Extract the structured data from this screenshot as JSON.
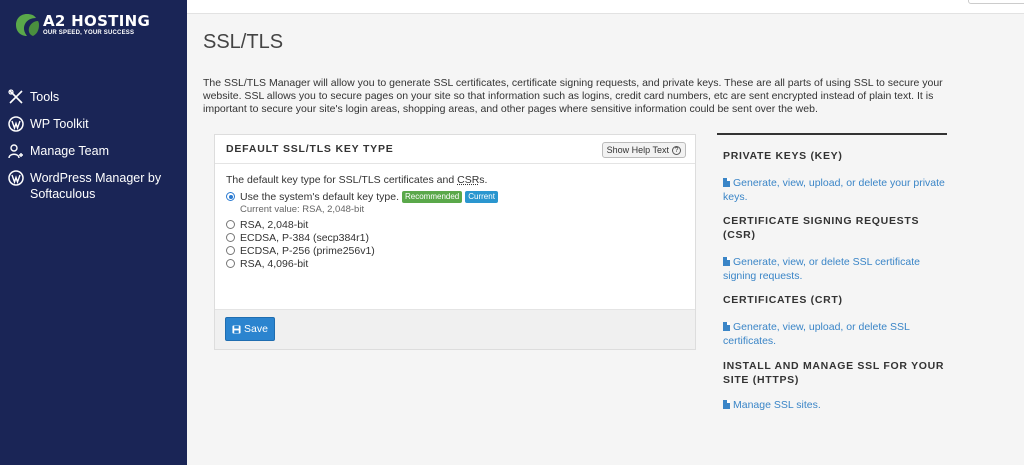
{
  "brand": {
    "name": "A2 HOSTING",
    "tagline": "OUR SPEED, YOUR SUCCESS",
    "color": "#5aa84a"
  },
  "sidebar": {
    "items": [
      {
        "label": "Tools",
        "icon": "tools-icon"
      },
      {
        "label": "WP Toolkit",
        "icon": "wordpress-icon"
      },
      {
        "label": "Manage Team",
        "icon": "user-group-icon"
      },
      {
        "label": "WordPress Manager by Softaculous",
        "icon": "wordpress-icon"
      }
    ]
  },
  "page": {
    "title": "SSL/TLS",
    "intro": "The SSL/TLS Manager will allow you to generate SSL certificates, certificate signing requests, and private keys. These are all parts of using SSL to secure your website. SSL allows you to secure pages on your site so that information such as logins, credit card numbers, etc are sent encrypted instead of plain text. It is important to secure your site's login areas, shopping areas, and other pages where sensitive information could be sent over the web."
  },
  "panel": {
    "title": "DEFAULT SSL/TLS KEY TYPE",
    "help_button": "Show Help Text",
    "description_prefix": "The default key type for SSL/TLS certificates and ",
    "description_csr": "CSR",
    "description_suffix": "s.",
    "options": [
      {
        "label": "Use the system's default key type.",
        "checked": true
      },
      {
        "label": "RSA, 2,048-bit",
        "checked": false
      },
      {
        "label": "ECDSA, P-384 (secp384r1)",
        "checked": false
      },
      {
        "label": "ECDSA, P-256 (prime256v1)",
        "checked": false
      },
      {
        "label": "RSA, 4,096-bit",
        "checked": false
      }
    ],
    "badge_recommended": "Recommended",
    "badge_current": "Current",
    "current_value": "Current value: RSA, 2,048-bit",
    "save_label": "Save"
  },
  "right": {
    "sections": [
      {
        "heading": "PRIVATE KEYS (KEY)",
        "link": "Generate, view, upload, or delete your private keys."
      },
      {
        "heading": "CERTIFICATE SIGNING REQUESTS (CSR)",
        "link": "Generate, view, or delete SSL certificate signing requests."
      },
      {
        "heading": "CERTIFICATES (CRT)",
        "link": "Generate, view, upload, or delete SSL certificates."
      },
      {
        "heading": "INSTALL AND MANAGE SSL FOR YOUR SITE (HTTPS)",
        "link": "Manage SSL sites."
      }
    ]
  },
  "colors": {
    "sidebar_bg": "#1a2556",
    "link": "#3a85c7",
    "primary_button": "#2b84cf",
    "badge_recommended": "#5aa84a",
    "badge_current": "#2a96cf"
  }
}
